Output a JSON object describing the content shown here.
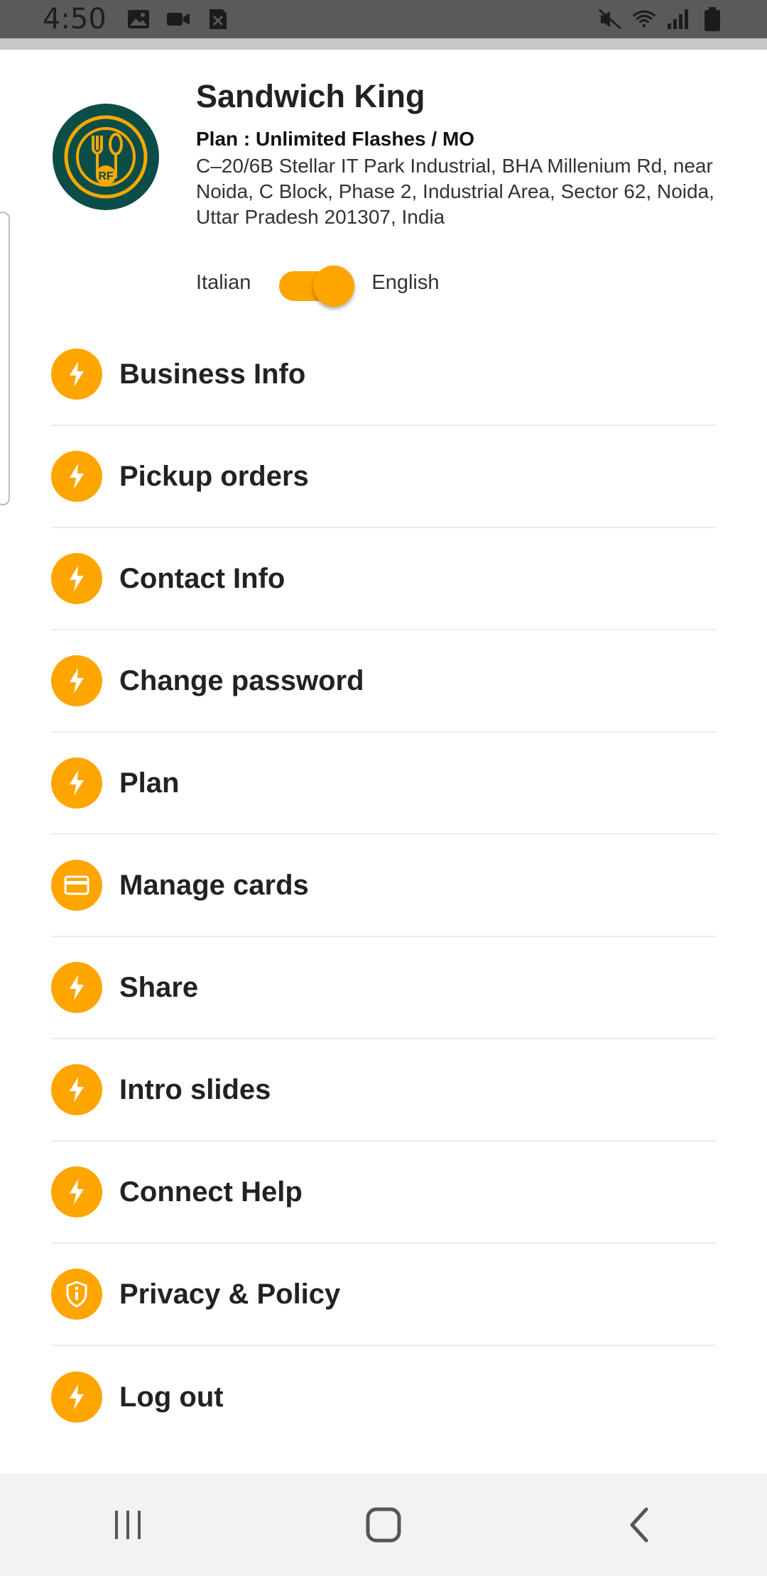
{
  "status_bar": {
    "time": "4:50",
    "left_icons": [
      "image-icon",
      "video-icon",
      "close-box-icon"
    ],
    "right_icons": [
      "mute-vibrate-icon",
      "wifi-icon",
      "signal-icon",
      "battery-icon"
    ]
  },
  "header": {
    "business_name": "Sandwich King",
    "plan": "Plan : Unlimited Flashes / MO",
    "address": "C–20/6B Stellar IT Park Industrial, BHA Millenium Rd, near Noida, C Block, Phase 2, Industrial Area, Sector 62, Noida, Uttar Pradesh 201307, India",
    "logo_text": "RF",
    "language_toggle": {
      "left_label": "Italian",
      "right_label": "English",
      "selected": "English"
    }
  },
  "menu": {
    "items": [
      {
        "label": "Business Info",
        "icon": "bolt-icon"
      },
      {
        "label": "Pickup orders",
        "icon": "bolt-icon"
      },
      {
        "label": "Contact Info",
        "icon": "bolt-icon"
      },
      {
        "label": "Change password",
        "icon": "bolt-icon"
      },
      {
        "label": "Plan",
        "icon": "bolt-icon"
      },
      {
        "label": "Manage cards",
        "icon": "credit-card-icon"
      },
      {
        "label": "Share",
        "icon": "bolt-icon"
      },
      {
        "label": "Intro slides",
        "icon": "bolt-icon"
      },
      {
        "label": "Connect Help",
        "icon": "bolt-icon"
      },
      {
        "label": "Privacy & Policy",
        "icon": "shield-icon"
      },
      {
        "label": "Log out",
        "icon": "bolt-icon"
      }
    ]
  },
  "nav_bar": {
    "buttons": [
      "recent-apps-icon",
      "home-icon",
      "back-icon"
    ]
  },
  "colors": {
    "accent": "#ffa500",
    "logo_bg": "#0d4d48",
    "status_bar": "#5a5a5a"
  }
}
